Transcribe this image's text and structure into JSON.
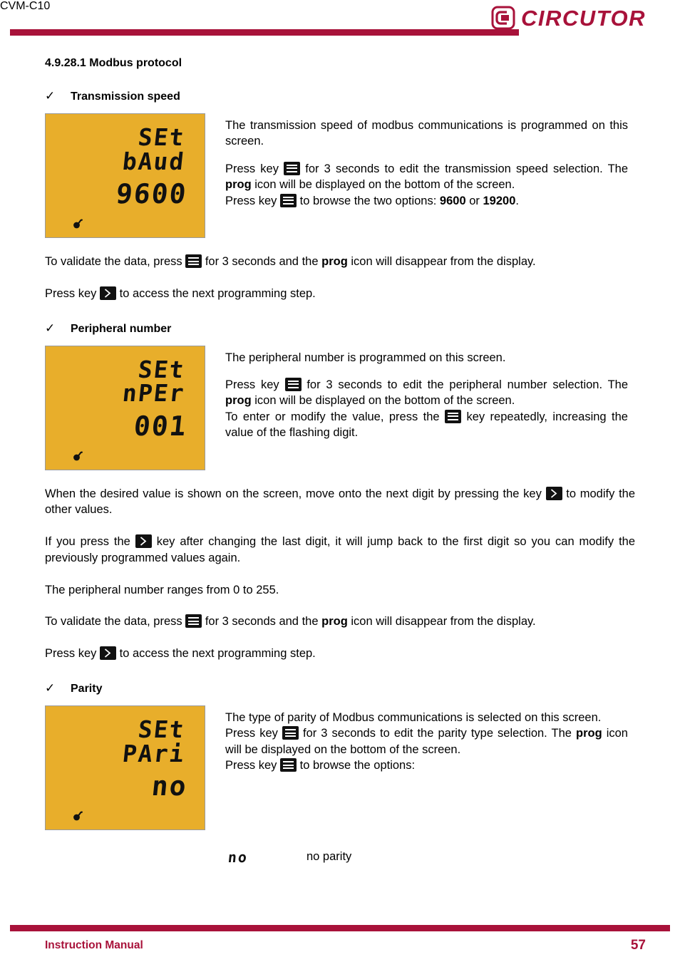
{
  "header": {
    "model": "CVM-C10",
    "brand": "CIRCUTOR",
    "rule_color": "#A8123A"
  },
  "section": {
    "heading": "4.9.28.1 Modbus protocol"
  },
  "icons": {
    "bullet_check": "✓",
    "menu_key": "menu-key-icon",
    "next_key": "next-key-icon",
    "lcd_key": "key-icon"
  },
  "subsections": [
    {
      "bullet": "✓",
      "label": "Transmission speed",
      "display": {
        "line1": "SEt",
        "line2": "bAud",
        "value": "9600",
        "background": "#E8AE2B"
      },
      "paragraphs": {
        "p1": "The transmission speed of modbus communications is programmed on this screen.",
        "p2_a": "Press key",
        "p2_b": "for 3 seconds to edit the transmission speed selection. The",
        "p2_bold": "prog",
        "p2_c": "icon will be displayed on the bottom of the screen.",
        "p3_a": "Press key",
        "p3_b": "to browse the two options:",
        "p3_opt1": "9600",
        "p3_or": "or",
        "p3_opt2": "19200",
        "p3_end": "."
      }
    },
    {
      "bullet": "✓",
      "label": "Peripheral number",
      "display": {
        "line1": "SEt",
        "line2": "nPEr",
        "value": "001",
        "background": "#E8AE2B"
      },
      "paragraphs": {
        "p1": "The peripheral number is programmed on this screen.",
        "p2_a": "Press key",
        "p2_b": "for 3 seconds to edit the peripheral number selection. The",
        "p2_bold": "prog",
        "p2_c": "icon will be displayed on the bottom of the screen.",
        "p3_a": "To enter or modify the value, press the",
        "p3_b": "key repeatedly, increasing the value of the flashing digit."
      }
    },
    {
      "bullet": "✓",
      "label": "Parity",
      "display": {
        "line1": "SEt",
        "line2": "PAri",
        "value": "no",
        "background": "#E8AE2B"
      },
      "paragraphs": {
        "p1": "The type of parity of Modbus communications is selected on this screen.",
        "p2_a": "Press key",
        "p2_b": "for 3 seconds to edit the parity type selection. The",
        "p2_bold": "prog",
        "p2_c": "icon will be displayed on the bottom of the screen.",
        "p3_a": "Press key",
        "p3_b": "to browse the options:"
      }
    }
  ],
  "shared_paragraphs": {
    "validate_a": "To validate the data, press",
    "validate_b": "for 3 seconds and the",
    "validate_bold": "prog",
    "validate_c": "icon will disappear from the display.",
    "next_step_a": "Press key",
    "next_step_b": "to access the next programming step.",
    "move_digit_a": "When the desired value is shown on the screen, move onto the next digit by pressing the key",
    "move_digit_b": "to modify the other values.",
    "wrap_digit_a": "If you press the",
    "wrap_digit_b": "key after changing the last digit, it will jump back to the first digit so you can modify the previously programmed values again.",
    "range": "The peripheral number ranges from 0 to 255."
  },
  "parity_options": [
    {
      "glyph": "no",
      "description": "no parity"
    }
  ],
  "footer": {
    "left": "Instruction Manual",
    "page": "57"
  }
}
